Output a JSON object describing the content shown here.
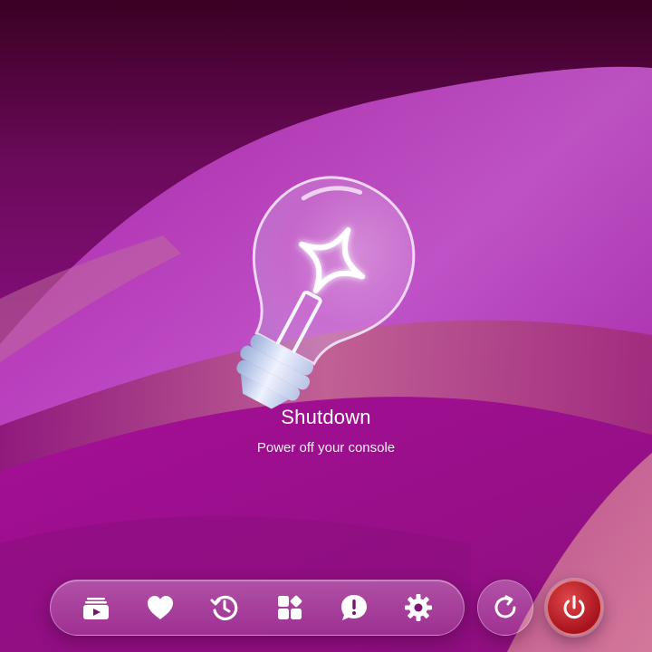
{
  "screen": {
    "title": "Shutdown",
    "subtitle": "Power off your console"
  },
  "hero_icon": "lightbulb-sparkle-icon",
  "dock": {
    "items": [
      {
        "icon": "media-library-icon"
      },
      {
        "icon": "heart-icon"
      },
      {
        "icon": "history-icon"
      },
      {
        "icon": "apps-grid-icon"
      },
      {
        "icon": "alert-bubble-icon"
      },
      {
        "icon": "gear-icon"
      }
    ]
  },
  "actions": {
    "restart": {
      "icon": "restart-icon"
    },
    "power": {
      "icon": "power-icon",
      "color": "#c41f26"
    }
  },
  "colors": {
    "background": "#7a0a6e",
    "accent": "#c41f26",
    "text": "#ffffff"
  }
}
